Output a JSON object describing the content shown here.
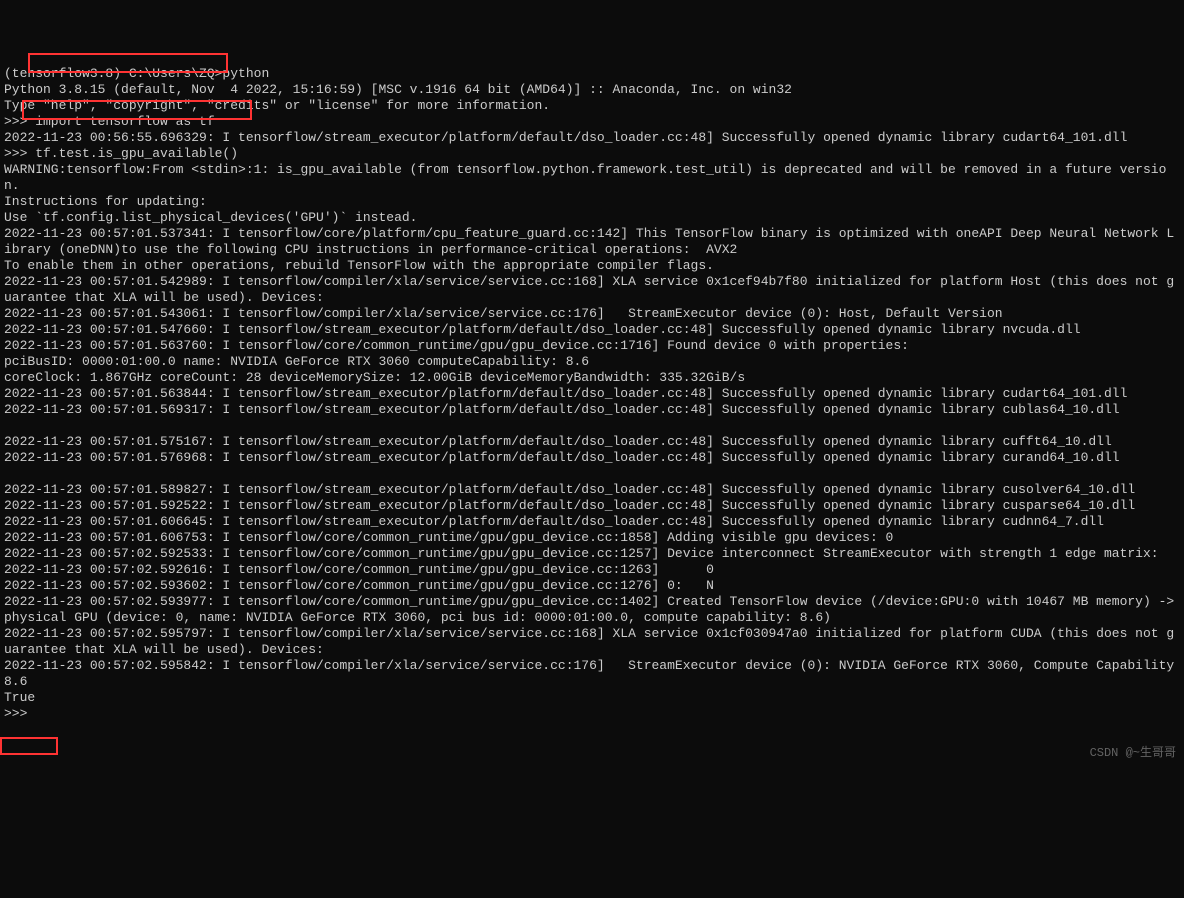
{
  "prompt_line": "(tensorflow3.8) C:\\Users\\ZQ>python",
  "python_banner1": "Python 3.8.15 (default, Nov  4 2022, 15:16:59) [MSC v.1916 64 bit (AMD64)] :: Anaconda, Inc. on win32",
  "python_banner2": "Type \"help\", \"copyright\", \"credits\" or \"license\" for more information.",
  "cmd1": ">>> import tensorflow as tf",
  "out1": "2022-11-23 00:56:55.696329: I tensorflow/stream_executor/platform/default/dso_loader.cc:48] Successfully opened dynamic library cudart64_101.dll",
  "cmd2": ">>> tf.test.is_gpu_available()",
  "out2": "WARNING:tensorflow:From <stdin>:1: is_gpu_available (from tensorflow.python.framework.test_util) is deprecated and will be removed in a future version.",
  "out3": "Instructions for updating:",
  "out4": "Use `tf.config.list_physical_devices('GPU')` instead.",
  "out5": "2022-11-23 00:57:01.537341: I tensorflow/core/platform/cpu_feature_guard.cc:142] This TensorFlow binary is optimized with oneAPI Deep Neural Network Library (oneDNN)to use the following CPU instructions in performance-critical operations:  AVX2",
  "out6": "To enable them in other operations, rebuild TensorFlow with the appropriate compiler flags.",
  "out7": "2022-11-23 00:57:01.542989: I tensorflow/compiler/xla/service/service.cc:168] XLA service 0x1cef94b7f80 initialized for platform Host (this does not guarantee that XLA will be used). Devices:",
  "out8": "2022-11-23 00:57:01.543061: I tensorflow/compiler/xla/service/service.cc:176]   StreamExecutor device (0): Host, Default Version",
  "out9": "2022-11-23 00:57:01.547660: I tensorflow/stream_executor/platform/default/dso_loader.cc:48] Successfully opened dynamic library nvcuda.dll",
  "out10": "2022-11-23 00:57:01.563760: I tensorflow/core/common_runtime/gpu/gpu_device.cc:1716] Found device 0 with properties:",
  "out11": "pciBusID: 0000:01:00.0 name: NVIDIA GeForce RTX 3060 computeCapability: 8.6",
  "out12": "coreClock: 1.867GHz coreCount: 28 deviceMemorySize: 12.00GiB deviceMemoryBandwidth: 335.32GiB/s",
  "out13": "2022-11-23 00:57:01.563844: I tensorflow/stream_executor/platform/default/dso_loader.cc:48] Successfully opened dynamic library cudart64_101.dll",
  "out14": "2022-11-23 00:57:01.569317: I tensorflow/stream_executor/platform/default/dso_loader.cc:48] Successfully opened dynamic library cublas64_10.dll",
  "blank": "",
  "out15": "2022-11-23 00:57:01.575167: I tensorflow/stream_executor/platform/default/dso_loader.cc:48] Successfully opened dynamic library cufft64_10.dll",
  "out16": "2022-11-23 00:57:01.576968: I tensorflow/stream_executor/platform/default/dso_loader.cc:48] Successfully opened dynamic library curand64_10.dll",
  "out17": "2022-11-23 00:57:01.589827: I tensorflow/stream_executor/platform/default/dso_loader.cc:48] Successfully opened dynamic library cusolver64_10.dll",
  "out18": "2022-11-23 00:57:01.592522: I tensorflow/stream_executor/platform/default/dso_loader.cc:48] Successfully opened dynamic library cusparse64_10.dll",
  "out19": "2022-11-23 00:57:01.606645: I tensorflow/stream_executor/platform/default/dso_loader.cc:48] Successfully opened dynamic library cudnn64_7.dll",
  "out20": "2022-11-23 00:57:01.606753: I tensorflow/core/common_runtime/gpu/gpu_device.cc:1858] Adding visible gpu devices: 0",
  "out21": "2022-11-23 00:57:02.592533: I tensorflow/core/common_runtime/gpu/gpu_device.cc:1257] Device interconnect StreamExecutor with strength 1 edge matrix:",
  "out22": "2022-11-23 00:57:02.592616: I tensorflow/core/common_runtime/gpu/gpu_device.cc:1263]      0",
  "out23": "2022-11-23 00:57:02.593602: I tensorflow/core/common_runtime/gpu/gpu_device.cc:1276] 0:   N",
  "out24": "2022-11-23 00:57:02.593977: I tensorflow/core/common_runtime/gpu/gpu_device.cc:1402] Created TensorFlow device (/device:GPU:0 with 10467 MB memory) -> physical GPU (device: 0, name: NVIDIA GeForce RTX 3060, pci bus id: 0000:01:00.0, compute capability: 8.6)",
  "out25": "2022-11-23 00:57:02.595797: I tensorflow/compiler/xla/service/service.cc:168] XLA service 0x1cf030947a0 initialized for platform CUDA (this does not guarantee that XLA will be used). Devices:",
  "out26": "2022-11-23 00:57:02.595842: I tensorflow/compiler/xla/service/service.cc:176]   StreamExecutor device (0): NVIDIA GeForce RTX 3060, Compute Capability 8.6",
  "result": "True",
  "prompt_next": ">>> ",
  "watermark": "CSDN @~生哥哥"
}
